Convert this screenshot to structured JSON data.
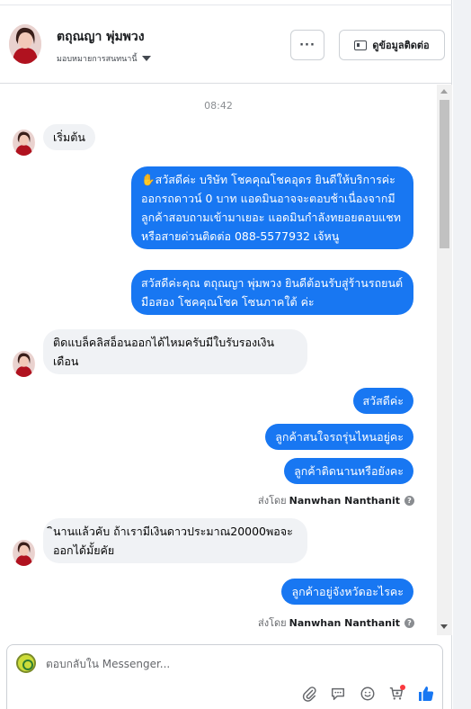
{
  "header": {
    "name": "ตถุณญา พุ่มพวง",
    "assign_label": "มอบหมายการสนทนานี้",
    "more_label": "···",
    "contact_label": "ดูข้อมูลติดต่อ"
  },
  "messages": {
    "timestamp": "08:42",
    "m1": "เริ่มต้น",
    "m2": "✋สวัสดีค่ะ บริษัท โชคคุณโชคอุดร ยินดีให้บริการค่ะ ออกรถดาวน์ 0 บาท แอดมินอาจจะตอบช้าเนื่องจากมีลูกค้าสอบถามเข้ามาเยอะ แอดมินกำลังทยอยตอบแชท หรือสายด่วนติดต่อ 088-5577932 เจ้หนู",
    "m3": "สวัสดีค่ะคุณ ตถุณญา พุ่มพวง ยินดีต้อนรับสู่ร้านรถยนต์มือสอง โชคคุณโชค โซนภาคใต้ ค่ะ",
    "m4": "ติดแบล็คลิสอ็อนออกได้ไหมครับมีใบรับรองเงินเดือน",
    "m5": "สวัสดีค่ะ",
    "m6": "ลูกค้าสนใจรถรุ่นไหนอยู่คะ",
    "m7": "ลูกค้าติดนานหรือยังคะ",
    "sent_by_prefix": "ส่งโดย",
    "sent_by_name": "Nanwhan Nanthanit",
    "m8": "ินานแล้วคับ  ถ้าเรามีเงินดาวประมาณ20000พอจะออกได้มั้ยคัย",
    "m9": "ลูกค้าอยู่จังหวัดอะไรคะ"
  },
  "composer": {
    "placeholder": "ตอบกลับใน Messenger..."
  },
  "colors": {
    "outgoing_bubble": "#1877f2",
    "incoming_bubble": "#f0f2f5",
    "like_icon": "#1877f2"
  },
  "icons": [
    "more-options-icon",
    "contact-card-icon",
    "chevron-down-icon",
    "attach-icon",
    "saved-reply-icon",
    "emoji-icon",
    "cart-icon",
    "like-icon",
    "help-icon"
  ]
}
